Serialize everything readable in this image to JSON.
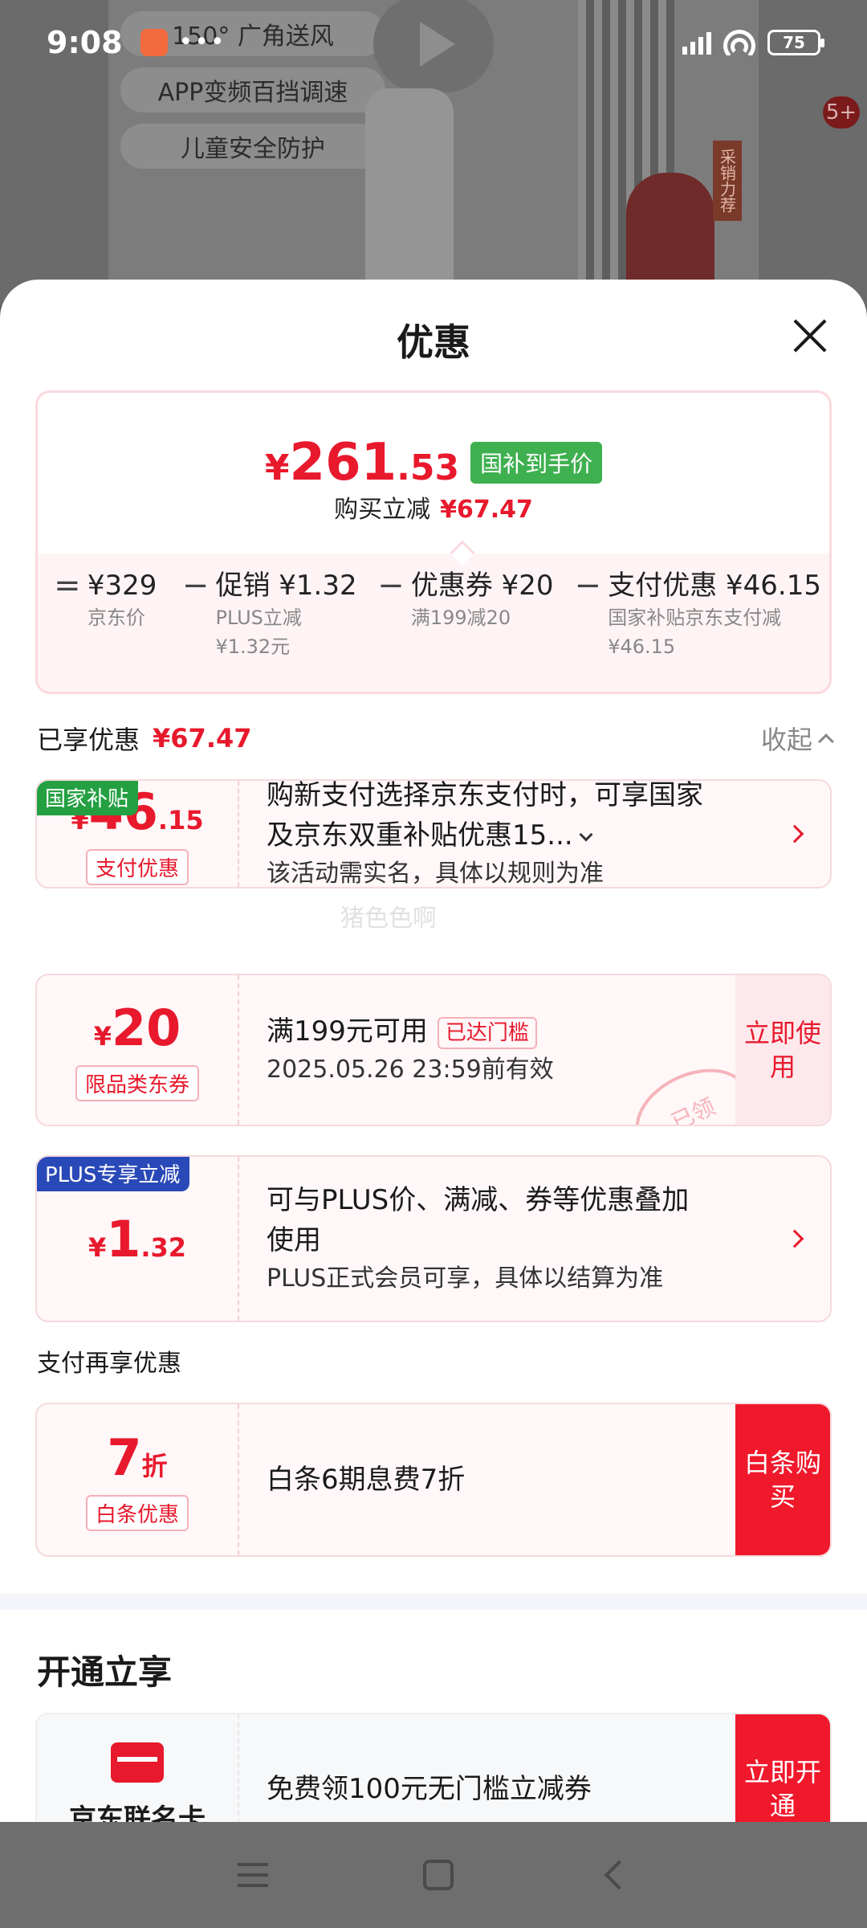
{
  "status_bar": {
    "time": "9:08",
    "dots": "•••",
    "battery": "75"
  },
  "background": {
    "features": [
      "150° 广角送风",
      "APP变频百挡调速",
      "儿童安全防护"
    ],
    "badge": "5+",
    "tag": "采销力荐"
  },
  "sheet": {
    "title": "优惠"
  },
  "price_box": {
    "currency": "¥",
    "price_int": "261",
    "price_dec": ".53",
    "price_tag": "国补到手价",
    "subtitle": "购买立减",
    "subtitle_amount": "¥67.47",
    "formula": {
      "equals": "=",
      "minus": "−",
      "terms": [
        {
          "amount": "¥329",
          "label1": "京东价",
          "label2": ""
        },
        {
          "amount": "促销 ¥1.32",
          "label1": "PLUS立减",
          "label2": "¥1.32元"
        },
        {
          "amount": "优惠券 ¥20",
          "label1": "满199减20",
          "label2": ""
        },
        {
          "amount": "支付优惠 ¥46.15",
          "label1": "国家补贴京东支付减",
          "label2": "¥46.15"
        }
      ]
    }
  },
  "enjoyed": {
    "label": "已享优惠",
    "amount": "¥67.47",
    "collapse": "收起"
  },
  "offers": [
    {
      "corner": "国家补贴",
      "amount_prefix": "¥",
      "amount_main": "46",
      "amount_dec": ".15",
      "tag": "支付优惠",
      "line1": "购新支付选择京东支付时，可享国家",
      "line1b": "及京东双重补贴优惠15...",
      "line2": "该活动需实名，具体以规则为准"
    },
    {
      "amount_prefix": "¥",
      "amount_main": "20",
      "tag": "限品类东券",
      "line1": "满199元可用",
      "inline_tag": "已达门槛",
      "line2": "2025.05.26 23:59前有效",
      "action": "立即使用",
      "stamp": "已领"
    },
    {
      "corner": "PLUS专享立减",
      "amount_prefix": "¥",
      "amount_main": "1",
      "amount_dec": ".32",
      "line1": "可与PLUS价、满减、券等优惠叠加",
      "line1b": "使用",
      "line2": "PLUS正式会员可享，具体以结算为准"
    }
  ],
  "pay_more": {
    "label": "支付再享优惠",
    "amount_main": "7",
    "amount_unit": "折",
    "tag": "白条优惠",
    "line1": "白条6期息费7折",
    "action": "白条购买"
  },
  "open_section": {
    "title": "开通立享",
    "left_text": "京东联名卡",
    "line1": "免费领100元无门槛立减券",
    "action": "立即开通"
  },
  "watermark": "猪色色啊",
  "colors": {
    "accent": "#e8192c",
    "green_tag": "#3fb04f",
    "plus_blue": "#2a49b8"
  }
}
